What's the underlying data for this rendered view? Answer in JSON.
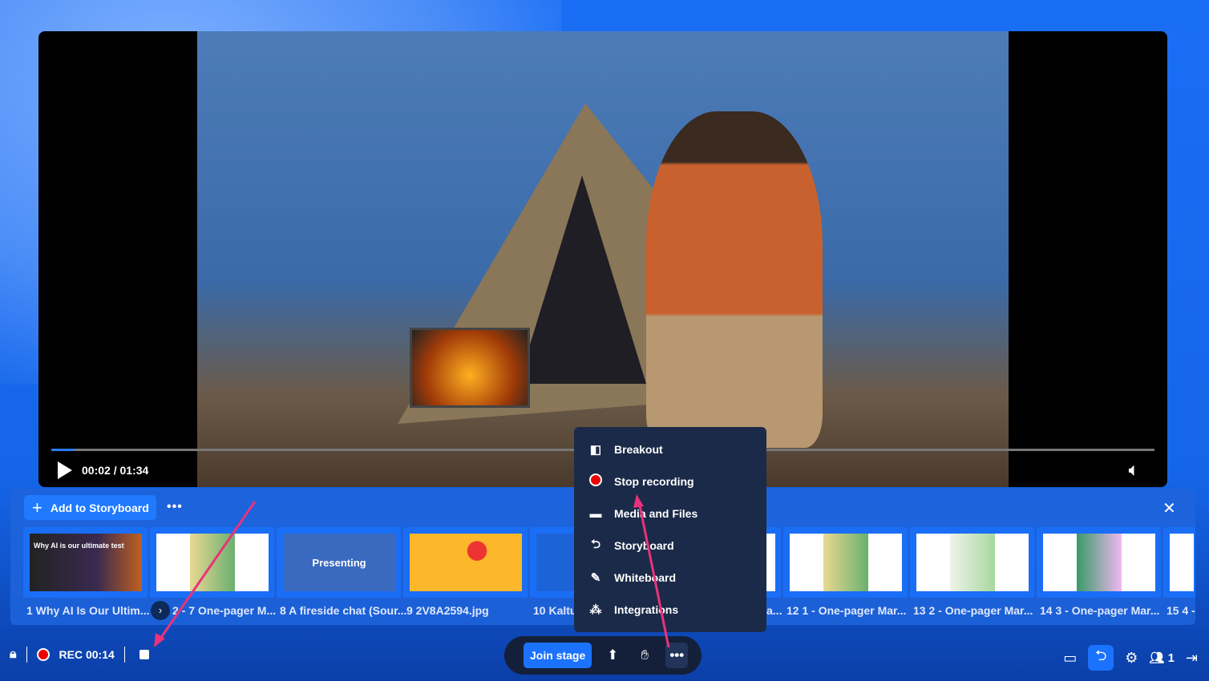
{
  "player": {
    "time": "00:02 / 01:34",
    "progress_percent": 2.1
  },
  "storyboard": {
    "add_label": "Add to Storyboard",
    "more_label": "•••",
    "close_label": "✕",
    "nav_label": "›",
    "items": [
      {
        "label": "1 Why AI Is Our Ultim...",
        "thumb_text": "Why AI is our ultimate test"
      },
      {
        "label": "2 - 7 One-pager M..."
      },
      {
        "label": "8 A fireside chat (Sour...",
        "thumb_text": "Presenting"
      },
      {
        "label": "9 2V8A2594.jpg"
      },
      {
        "label": "10 Kaltu"
      },
      {
        "label": "a..."
      },
      {
        "label": "12 1 - One-pager Mar..."
      },
      {
        "label": "13 2 - One-pager Mar..."
      },
      {
        "label": "14 3 - One-pager Mar..."
      },
      {
        "label": "15 4 -"
      }
    ]
  },
  "menu": {
    "items": [
      {
        "label": "Breakout",
        "icon": "breakout-icon"
      },
      {
        "label": "Stop recording",
        "icon": "record-icon"
      },
      {
        "label": "Media and Files",
        "icon": "folder-icon"
      },
      {
        "label": "Storyboard",
        "icon": "storyboard-icon"
      },
      {
        "label": "Whiteboard",
        "icon": "whiteboard-icon"
      },
      {
        "label": "Integrations",
        "icon": "integrations-icon"
      }
    ]
  },
  "bottom": {
    "rec_label": "REC 00:14",
    "join_label": "Join stage",
    "participants": "1"
  },
  "colors": {
    "accent": "#1a72ff",
    "record": "#e00000",
    "menu_bg": "#1b2a48",
    "annotation": "#e8337a"
  }
}
